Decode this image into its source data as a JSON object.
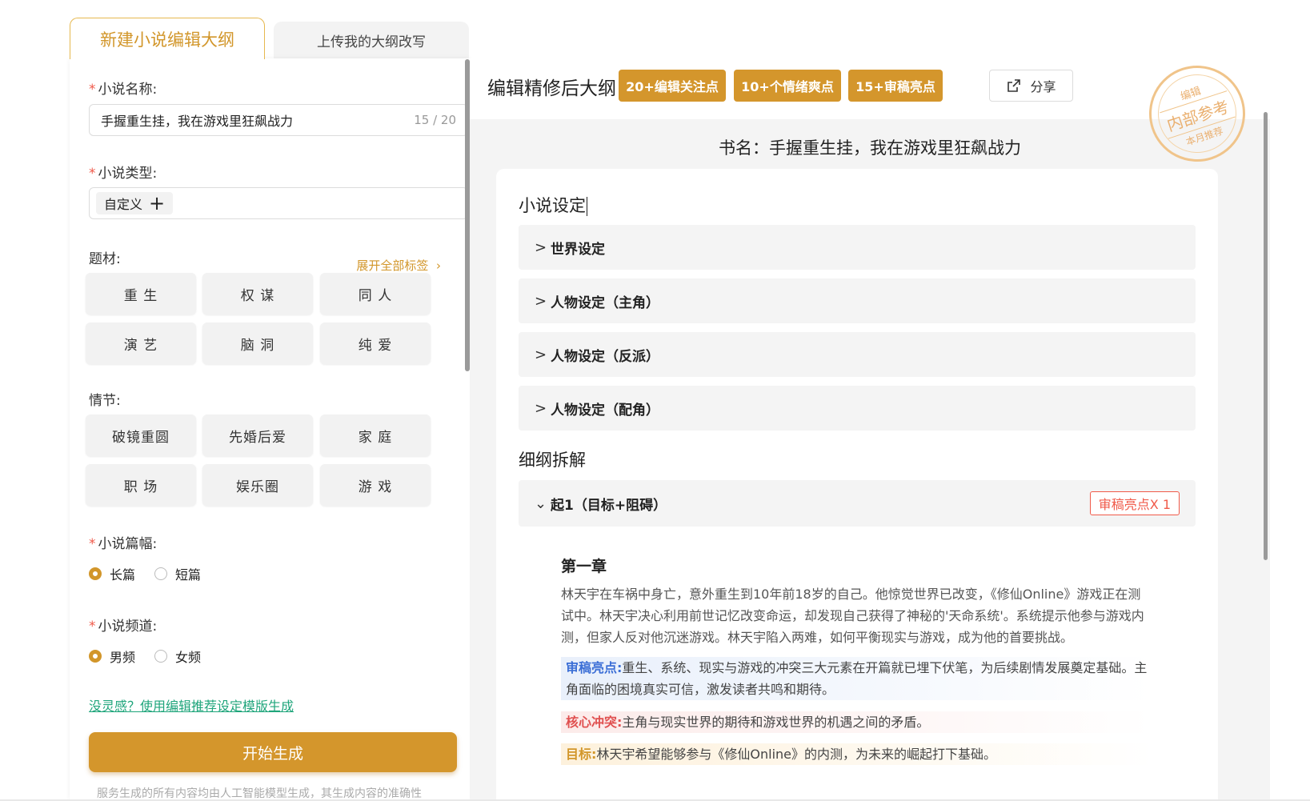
{
  "tabs": {
    "active": "新建小说编辑大纲",
    "inactive": "上传我的大纲改写"
  },
  "form": {
    "name_label": "小说名称:",
    "name_value": "手握重生挂，我在游戏里狂飙战力",
    "name_count": "15 / 20",
    "type_label": "小说类型:",
    "type_chip": "自定义",
    "theme_label": "题材:",
    "expand_label": "展开全部标签",
    "theme_tags": [
      "重 生",
      "权 谋",
      "同 人",
      "演 艺",
      "脑 洞",
      "纯 爱"
    ],
    "plot_label": "情节:",
    "plot_tags": [
      "破镜重圆",
      "先婚后爱",
      "家 庭",
      "职 场",
      "娱乐圈",
      "游 戏"
    ],
    "length_label": "小说篇幅:",
    "length_options": [
      "长篇",
      "短篇"
    ],
    "length_selected": "长篇",
    "channel_label": "小说频道:",
    "channel_options": [
      "男频",
      "女频"
    ],
    "channel_selected": "男频"
  },
  "footer": {
    "link_text": "没灵感？使用编辑推荐设定模版生成",
    "generate_label": "开始生成",
    "disclaimer": "服务生成的所有内容均由人工智能模型生成，其生成内容的准确性"
  },
  "right": {
    "title": "编辑精修后大纲",
    "badges": [
      "20+编辑关注点",
      "10+个情绪爽点",
      "15+审稿亮点"
    ],
    "share_label": "分享",
    "stamp": {
      "top": "编辑",
      "middle": "内部参考",
      "bottom": "本月推荐"
    },
    "book_title": "书名：手握重生挂，我在游戏里狂飙战力",
    "settings_heading": "小说设定",
    "settings_items": [
      "世界设定",
      "人物设定（主角）",
      "人物设定（反派）",
      "人物设定（配角）"
    ],
    "breakdown_heading": "细纲拆解",
    "section_title": "起1（目标+阻碍）",
    "section_tag": "审稿亮点X 1",
    "chapter_title": "第一章",
    "chapter_text": "林天宇在车祸中身亡，意外重生到10年前18岁的自己。他惊觉世界已改变，《修仙Online》游戏正在测试中。林天宇决心利用前世记忆改变命运，却发现自己获得了神秘的'天命系统'。系统提示他参与游戏内测，但家人反对他沉迷游戏。林天宇陷入两难，如何平衡现实与游戏，成为他的首要挑战。",
    "highlight_label": "审稿亮点:",
    "highlight_text": "重生、系统、现实与游戏的冲突三大元素在开篇就已埋下伏笔，为后续剧情发展奠定基础。主角面临的困境真实可信，激发读者共鸣和期待。",
    "conflict_label": "核心冲突:",
    "conflict_text": "主角与现实世界的期待和游戏世界的机遇之间的矛盾。",
    "goal_label": "目标:",
    "goal_text": "林天宇希望能够参与《修仙Online》的内测，为未来的崛起打下基础。"
  },
  "colors": {
    "accent": "#d4962c",
    "link": "#1fa57b",
    "required": "#f05a4a"
  }
}
